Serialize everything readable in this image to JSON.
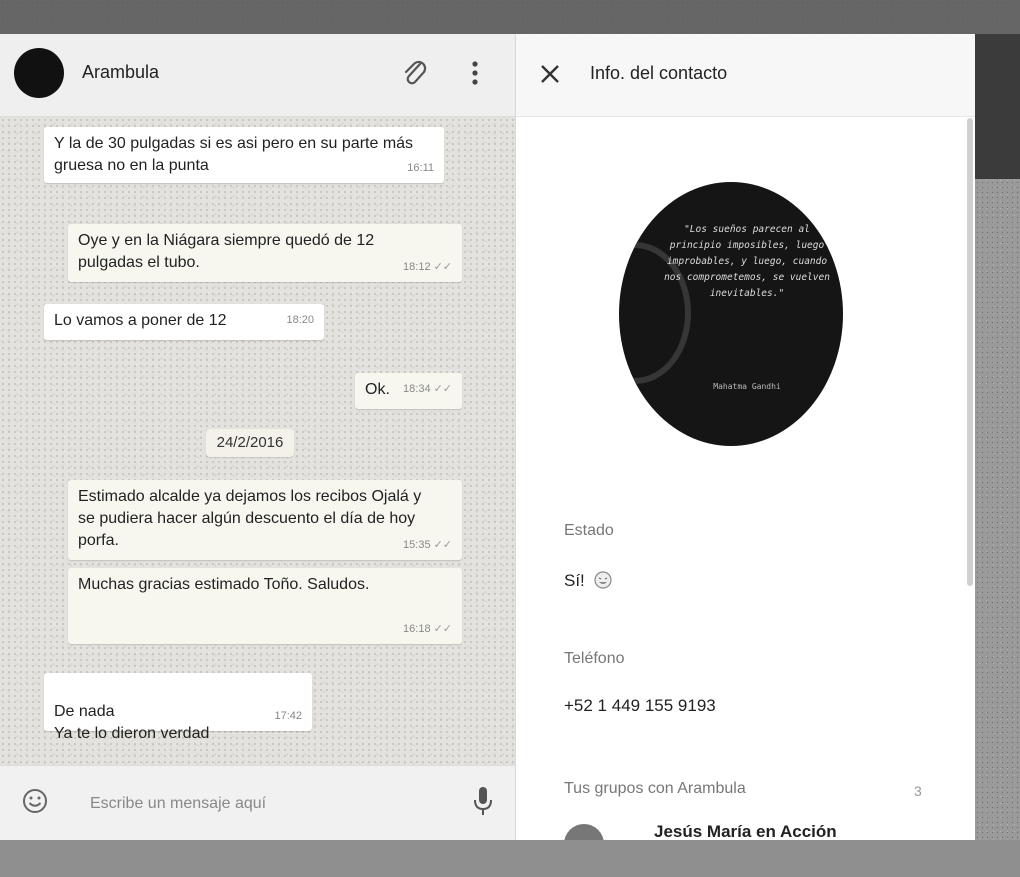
{
  "chat": {
    "contact_name": "Arambula",
    "messages": [
      {
        "text": "Y la de 30 pulgadas si es asi pero en su parte más gruesa no en la punta",
        "time": "16:11",
        "direction": "in"
      },
      {
        "text": "Oye y en la Niágara siempre quedó de 12 pulgadas el tubo.",
        "time": "18:12",
        "direction": "out",
        "ticks": "✓✓"
      },
      {
        "text": "Lo vamos a poner de 12",
        "time": "18:20",
        "direction": "in"
      },
      {
        "text": "Ok.",
        "time": "18:34",
        "direction": "out",
        "ticks": "✓✓"
      },
      {
        "text": "Estimado alcalde ya dejamos los recibos Ojalá y se pudiera hacer algún descuento el día de hoy porfa.",
        "time": "15:35",
        "direction": "out",
        "ticks": "✓✓"
      },
      {
        "text": "Muchas gracias estimado Toño. Saludos.",
        "time": "16:18",
        "direction": "out",
        "ticks": "✓✓"
      },
      {
        "text": "De nada\nYa te lo dieron verdad",
        "time": "17:42",
        "direction": "in"
      }
    ],
    "date_divider": "24/2/2016",
    "composer_placeholder": "Escribe un mensaje aquí"
  },
  "info": {
    "title": "Info. del contacto",
    "quote": "\"Los sueños parecen al principio imposibles, luego improbables, y luego, cuando nos comprometemos, se vuelven inevitables.\"",
    "quote_author": "Mahatma Gandhi",
    "status_label": "Estado",
    "status_value": "Sí!",
    "phone_label": "Teléfono",
    "phone_value": "+52 1 449 155 9193",
    "groups_label": "Tus grupos con Arambula",
    "groups_count": "3",
    "group_first": "Jesús María en Acción"
  }
}
